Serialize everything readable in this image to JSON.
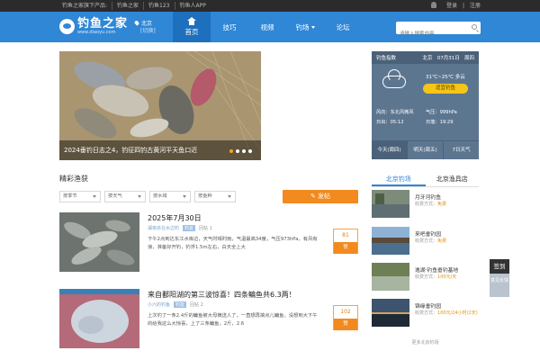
{
  "topbar": {
    "links": [
      "钓鱼之家旗下产品:",
      "钓鱼之家",
      "钓鱼123",
      "钓鱼人APP"
    ],
    "login": "登录",
    "register": "注册"
  },
  "header": {
    "logo_name": "钓鱼之家",
    "logo_domain": "www.diaoyu.com",
    "city": "北京",
    "city_switch": "[切换]",
    "nav": [
      {
        "label": "首页",
        "active": true
      },
      {
        "label": "技巧"
      },
      {
        "label": "视频"
      },
      {
        "label": "钓场"
      },
      {
        "label": "论坛"
      }
    ],
    "search_placeholder": "请输入搜索内容"
  },
  "banner": {
    "caption": "2024垂钓日志之4，钓征四钓古黄河平天鱼口近",
    "dots": 4,
    "active_dot": 0
  },
  "weather": {
    "title": "钓鱼指数",
    "city": "北京",
    "date": "07月31日",
    "weekday": "周四",
    "icon": "cloudy-icon",
    "temp": "31℃~25℃ 多云",
    "verdict": "适宜钓鱼",
    "wind_label": "风向：东北风微风",
    "pressure_label": "气压：999hPa",
    "sunrise_label": "日出：05:12",
    "sunset_label": "日落：19:29",
    "tabs": [
      "今天(周四)",
      "明天(周五)",
      "7日天气"
    ]
  },
  "section": {
    "title": "精彩渔获",
    "filters": [
      "按季节",
      "按天气",
      "按水域",
      "按鱼种"
    ],
    "post_button": "发帖"
  },
  "posts": [
    {
      "title": "2025年7月30日",
      "author": "澜夜杀在水边钓",
      "tag": "钓友",
      "comments": "回帖 1",
      "body": "下午2点到达东江水库边，天气时晴时雨，气温最高34度，气压973hPa，有风有浪，准备好开钓，钓浮1.5m左右，白天全上大",
      "count": "81",
      "count_label": "赞"
    },
    {
      "title": "来自鄱阳湖的第三波惊喜！四条鳊鱼共6.3两！",
      "author": "小六的钓鱼",
      "tag": "钓友",
      "comments": "回帖 2",
      "body": "上次钓了一条2.4斤的鳊鱼被大母摘送人了，一直想再搞点儿鳊鱼，没想到大下午的给我这么大惊喜，上了三条鳊鱼，2斤，2.6",
      "count": "102",
      "count_label": "赞"
    }
  ],
  "side": {
    "tabs": [
      "北京钓场",
      "北京渔具店"
    ],
    "spots": [
      {
        "name": "月牙河钓鱼",
        "fee_label": "收费方式：",
        "fee": "免费"
      },
      {
        "name": "来吧垂钓园",
        "fee_label": "收费方式：",
        "fee": "免费"
      },
      {
        "name": "逸湖·钓鱼垂钓基地",
        "fee_label": "收费方式：",
        "fee": "100元/天"
      },
      {
        "name": "锦缘垂钓园",
        "fee_label": "收费方式：",
        "fee": "100元/24小时(2天)"
      }
    ],
    "more": "更多北京钓场"
  },
  "float": {
    "sign": "签到",
    "feedback": "意见反馈"
  }
}
